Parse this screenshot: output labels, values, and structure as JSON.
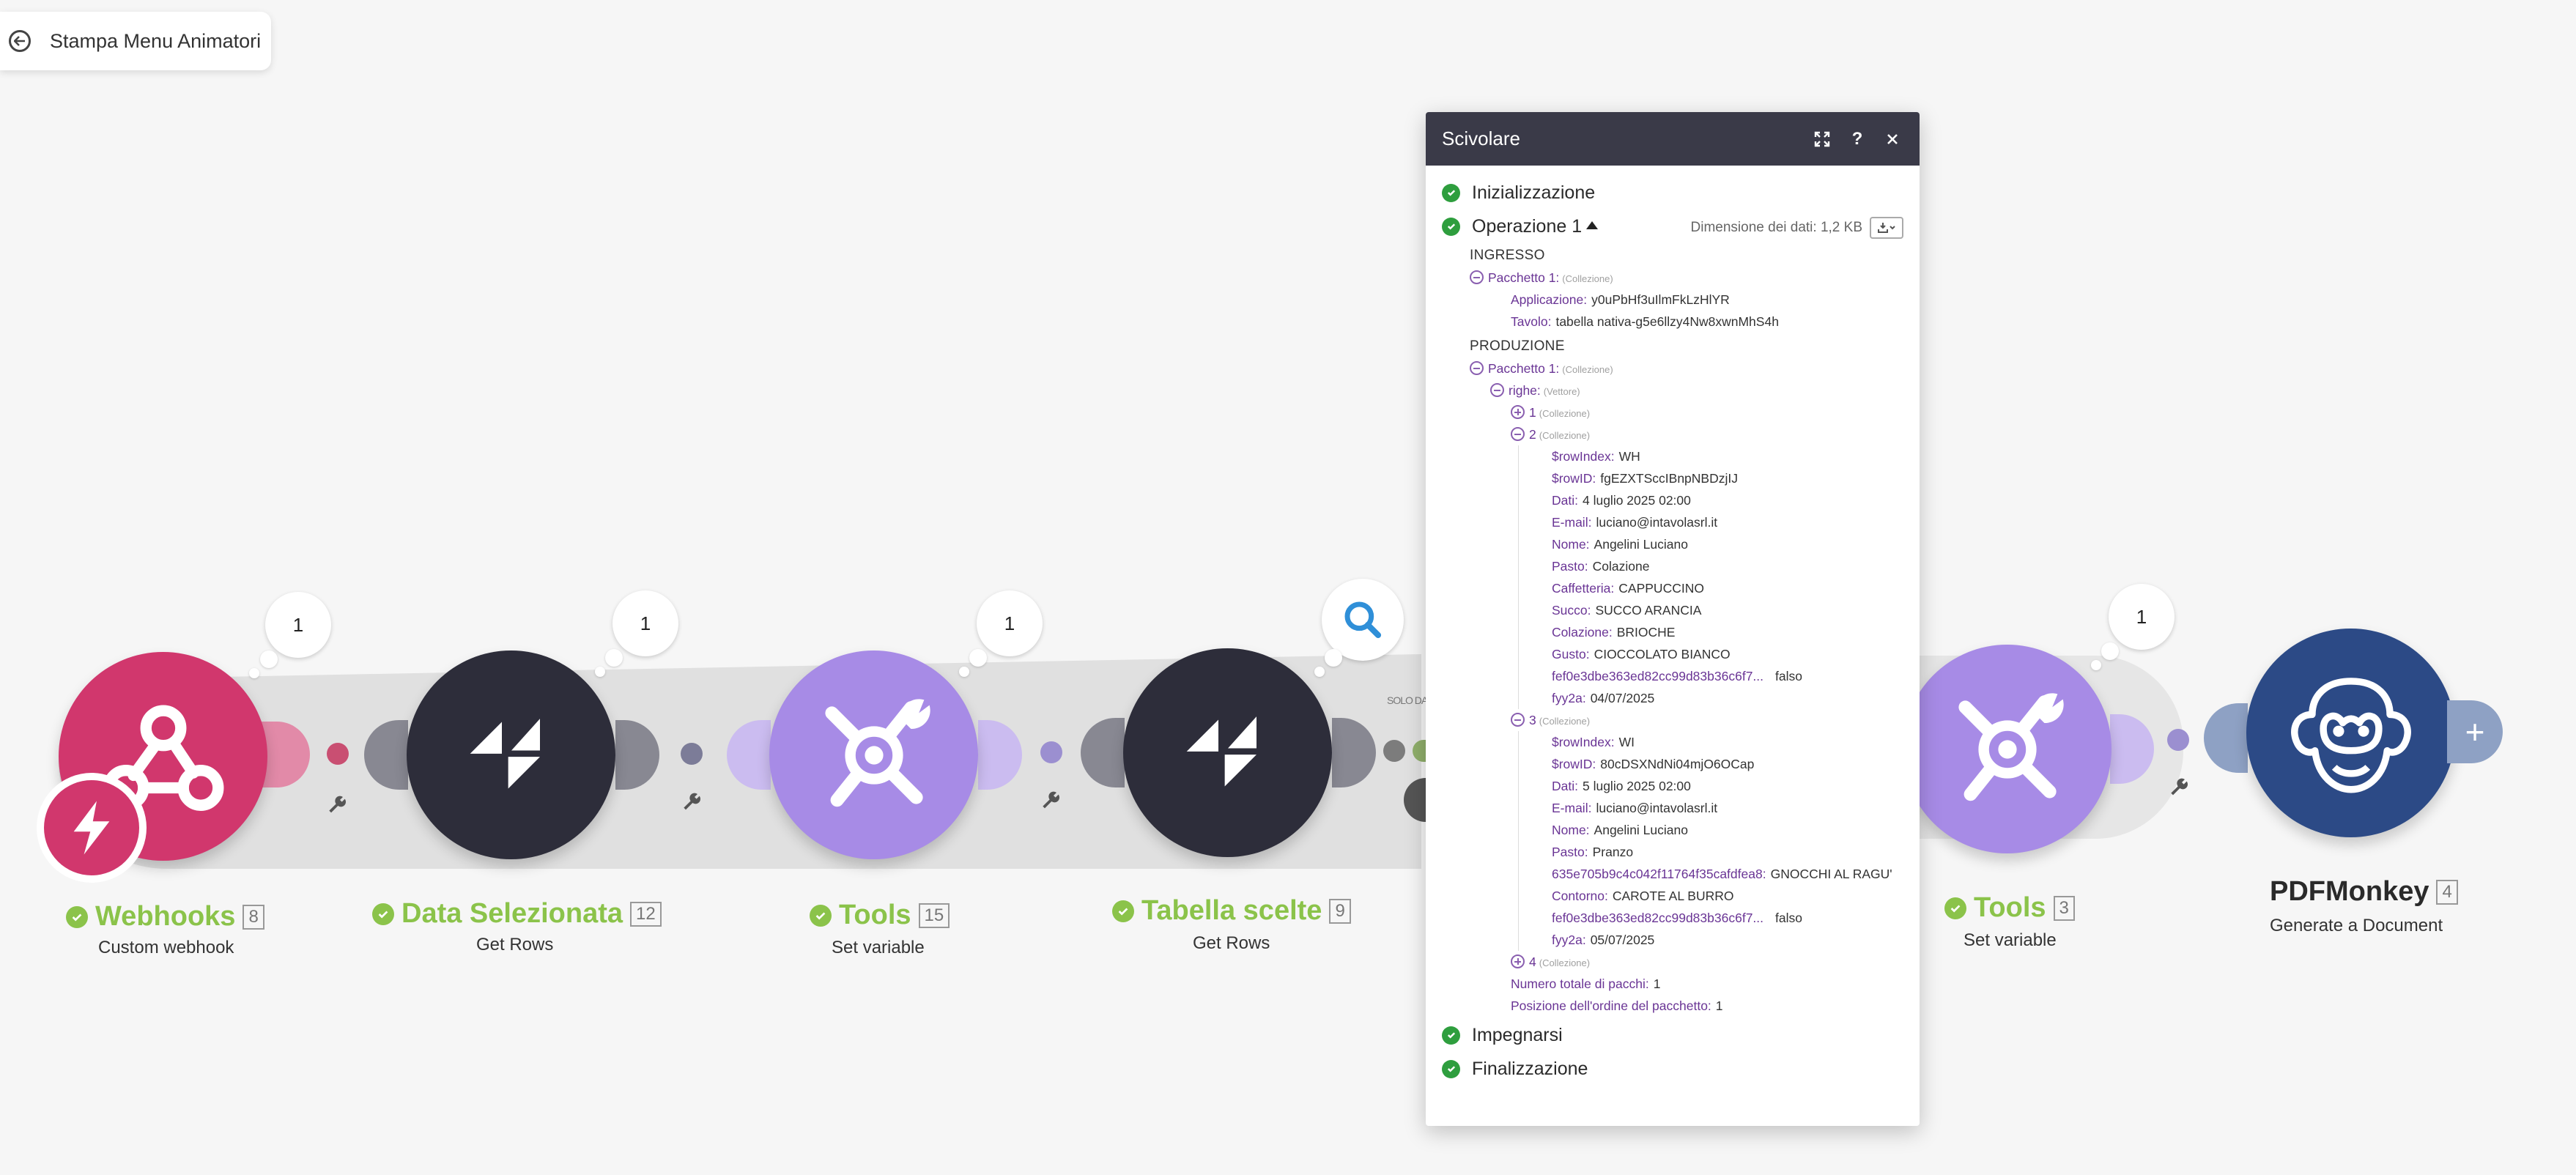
{
  "scenario": {
    "title": "Stampa Menu Animatori"
  },
  "modules": [
    {
      "name": "Webhooks",
      "count": "8",
      "subtitle": "Custom webhook",
      "bubble": "1"
    },
    {
      "name": "Data Selezionata",
      "count": "12",
      "subtitle": "Get Rows",
      "bubble": "1"
    },
    {
      "name": "Tools",
      "count": "15",
      "subtitle": "Set variable",
      "bubble": "1"
    },
    {
      "name": "Tabella scelte",
      "count": "9",
      "subtitle": "Get Rows"
    },
    {
      "name": "Tools",
      "count": "3",
      "subtitle": "Set variable",
      "bubble": "1"
    },
    {
      "name": "PDFMonkey",
      "count": "4",
      "subtitle": "Generate a Document"
    }
  ],
  "filter_label": "SOLO DATE S",
  "colors": {
    "webhook": "#d1376d",
    "dark": "#2d2d3a",
    "tools": "#a78be6",
    "pdfmonkey": "#2c4a86",
    "green": "#8bc34a",
    "panel_header": "#3a3a48"
  },
  "panel": {
    "title": "Scivolare",
    "initialization": "Inizializzazione",
    "operation": "Operazione 1",
    "data_size": "Dimensione dei dati: 1,2 KB",
    "commit": "Impegnarsi",
    "finalization": "Finalizzazione",
    "input": {
      "heading": "INGRESSO",
      "bundle": "Pacchetto 1:",
      "bundle_type": "(Collezione)",
      "fields": [
        {
          "key": "Applicazione:",
          "value": "y0uPbHf3uIlmFkLzHlYR"
        },
        {
          "key": "Tavolo:",
          "value": "tabella nativa-g5e6llzy4Nw8xwnMhS4h"
        }
      ]
    },
    "output": {
      "heading": "PRODUZIONE",
      "bundle": "Pacchetto 1:",
      "bundle_type": "(Collezione)",
      "rows_key": "righe:",
      "rows_type": "(Vettore)",
      "item1": {
        "key": "1",
        "type": "(Collezione)"
      },
      "item2": {
        "key": "2",
        "type": "(Collezione)",
        "fields": [
          {
            "key": "$rowIndex:",
            "value": "WH"
          },
          {
            "key": "$rowID:",
            "value": "fgEZXTSccIBnpNBDzjIJ"
          },
          {
            "key": "Dati:",
            "value": "4 luglio 2025 02:00"
          },
          {
            "key": "E-mail:",
            "value": "luciano@intavolasrl.it"
          },
          {
            "key": "Nome:",
            "value": "Angelini Luciano"
          },
          {
            "key": "Pasto:",
            "value": "Colazione"
          },
          {
            "key": "Caffetteria:",
            "value": "CAPPUCCINO"
          },
          {
            "key": "Succo:",
            "value": "SUCCO ARANCIA"
          },
          {
            "key": "Colazione:",
            "value": "BRIOCHE"
          },
          {
            "key": "Gusto:",
            "value": "CIOCCOLATO BIANCO"
          },
          {
            "key": "fef0e3dbe363ed82cc99d83b36c6f7...",
            "value": "falso"
          },
          {
            "key": "fyy2a:",
            "value": "04/07/2025"
          }
        ]
      },
      "item3": {
        "key": "3",
        "type": "(Collezione)",
        "fields": [
          {
            "key": "$rowIndex:",
            "value": "WI"
          },
          {
            "key": "$rowID:",
            "value": "80cDSXNdNi04mjO6OCap"
          },
          {
            "key": "Dati:",
            "value": "5 luglio 2025 02:00"
          },
          {
            "key": "E-mail:",
            "value": "luciano@intavolasrl.it"
          },
          {
            "key": "Nome:",
            "value": "Angelini Luciano"
          },
          {
            "key": "Pasto:",
            "value": "Pranzo"
          },
          {
            "key": "635e705b9c4c042f11764f35cafdfea8:",
            "value": "GNOCCHI AL RAGU'"
          },
          {
            "key": "Contorno:",
            "value": "CAROTE AL BURRO"
          },
          {
            "key": "fef0e3dbe363ed82cc99d83b36c6f7...",
            "value": "falso"
          },
          {
            "key": "fyy2a:",
            "value": "05/07/2025"
          }
        ]
      },
      "item4": {
        "key": "4",
        "type": "(Collezione)"
      },
      "total_bundles": {
        "key": "Numero totale di pacchi:",
        "value": "1"
      },
      "bundle_position": {
        "key": "Posizione dell'ordine del pacchetto:",
        "value": "1"
      }
    }
  }
}
